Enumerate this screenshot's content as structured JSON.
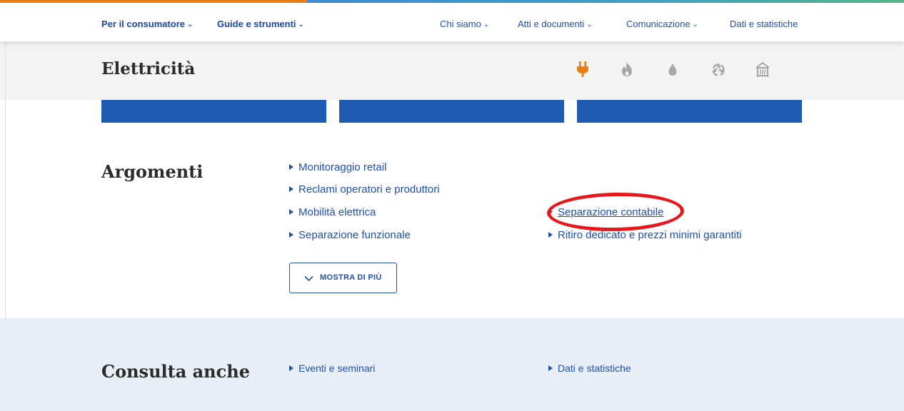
{
  "colors": {
    "primary": "#1f4fa8",
    "tile": "#1e5cb3",
    "accent_orange": "#e87e16",
    "highlight": "#e8171c",
    "footer_bg": "#e8eef6"
  },
  "topnav": {
    "items": [
      {
        "label": "Per il consumatore",
        "bold": true,
        "icon": "chevron-down-icon"
      },
      {
        "label": "Guide e strumenti",
        "bold": true,
        "icon": "chevron-down-icon"
      },
      {
        "label": "Chi siamo",
        "icon": "chevron-down-icon"
      },
      {
        "label": "Atti e documenti",
        "icon": "chevron-down-icon"
      },
      {
        "label": "Comunicazione",
        "icon": "chevron-down-icon"
      },
      {
        "label": "Dati e statistiche"
      }
    ]
  },
  "header": {
    "title": "Elettricità",
    "sector_icons": [
      "plug-icon",
      "flame-icon",
      "water-drop-icon",
      "recycle-icon",
      "district-heating-icon"
    ],
    "active_sector": "plug-icon"
  },
  "argomenti": {
    "title": "Argomenti",
    "links_col1": [
      "Monitoraggio retail",
      "Reclami operatori e produttori",
      "Mobilità elettrica",
      "Separazione funzionale"
    ],
    "links_col2": [
      "Separazione contabile",
      "Ritiro dedicato e prezzi minimi garantiti"
    ],
    "show_more_label": "MOSTRA DI PIÙ"
  },
  "consulta": {
    "title": "Consulta anche",
    "links": [
      "Eventi e seminari",
      "Dati e statistiche"
    ]
  }
}
